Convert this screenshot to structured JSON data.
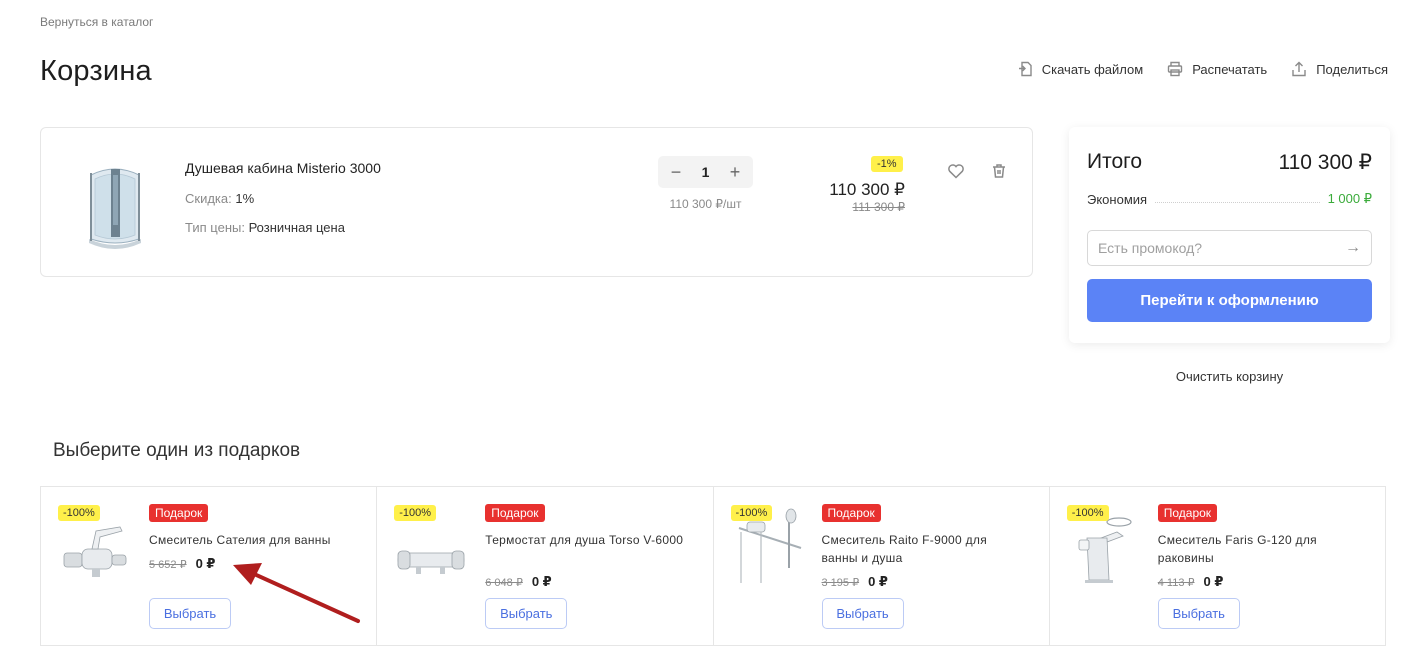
{
  "nav": {
    "back_label": "Вернуться в каталог"
  },
  "page": {
    "title": "Корзина"
  },
  "actions": [
    {
      "label": "Скачать файлом",
      "icon": "download-file-icon"
    },
    {
      "label": "Распечатать",
      "icon": "printer-icon"
    },
    {
      "label": "Поделиться",
      "icon": "share-icon"
    }
  ],
  "cart_item": {
    "name": "Душевая кабина Misterio 3000",
    "discount_label": "Скидка:",
    "discount_value": "1%",
    "price_type_label": "Тип цены:",
    "price_type_value": "Розничная цена",
    "quantity": "1",
    "unit_price": "110 300 ₽/шт",
    "badge": "-1%",
    "price": "110 300 ₽",
    "old_price": "111 300 ₽"
  },
  "summary": {
    "title": "Итого",
    "total": "110 300 ₽",
    "savings_label": "Экономия",
    "savings_amount": "1 000 ₽",
    "promo_placeholder": "Есть промокод?",
    "promo_value": "",
    "checkout_label": "Перейти к оформлению",
    "clear_label": "Очистить корзину"
  },
  "gifts": {
    "title": "Выберите один из подарков",
    "items": [
      {
        "badge": "-100%",
        "tag": "Подарок",
        "name": "Смеситель Сателия для ванны",
        "old_price": "5 652 ₽",
        "price": "0 ₽",
        "button": "Выбрать"
      },
      {
        "badge": "-100%",
        "tag": "Подарок",
        "name": "Термостат для душа Torso V-6000",
        "old_price": "6 048 ₽",
        "price": "0 ₽",
        "button": "Выбрать"
      },
      {
        "badge": "-100%",
        "tag": "Подарок",
        "name": "Смеситель Raito F-9000 для ванны и душа",
        "old_price": "3 195 ₽",
        "price": "0 ₽",
        "button": "Выбрать"
      },
      {
        "badge": "-100%",
        "tag": "Подарок",
        "name": "Смеситель Faris G-120 для раковины",
        "old_price": "4 113 ₽",
        "price": "0 ₽",
        "button": "Выбрать"
      }
    ]
  },
  "colors": {
    "accent": "#5b83f6",
    "savings": "#3bab3b",
    "gift_tag": "#e8312f",
    "discount_badge": "#fff04a",
    "annotation_arrow": "#b01e1e"
  }
}
